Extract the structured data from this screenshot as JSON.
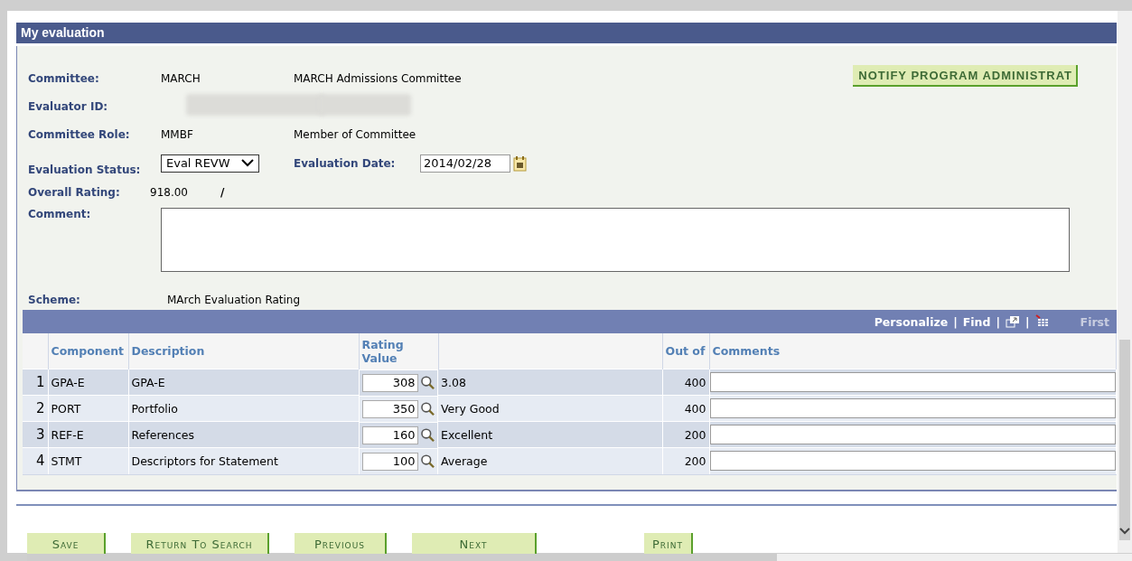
{
  "section": {
    "title": "My evaluation"
  },
  "notify_button": "NOTIFY PROGRAM ADMINISTRAT",
  "fields": [
    {
      "kind": "text",
      "label": "Committee:",
      "code": "MARCH",
      "description": "MARCH Admissions Committee"
    },
    {
      "kind": "blurred",
      "label": "Evaluator ID:"
    },
    {
      "kind": "text",
      "label": "Committee Role:",
      "code": "MMBF",
      "description": "Member of Committee"
    }
  ],
  "status": {
    "label": "Evaluation Status:",
    "value": "Eval REVW"
  },
  "date": {
    "label": "Evaluation Date:",
    "value": "2014/02/28"
  },
  "overall": {
    "label": "Overall Rating:",
    "value": "918.00",
    "separator": "/"
  },
  "comment": {
    "label": "Comment:"
  },
  "scheme": {
    "label": "Scheme:",
    "value": "MArch Evaluation Rating"
  },
  "grid_toolbar": [
    {
      "kind": "link",
      "text": "Personalize"
    },
    {
      "kind": "sep",
      "text": "|"
    },
    {
      "kind": "link",
      "text": "Find"
    },
    {
      "kind": "sep",
      "text": "|"
    },
    {
      "kind": "zoom"
    },
    {
      "kind": "sep",
      "text": "|"
    },
    {
      "kind": "download"
    }
  ],
  "grid_nav": {
    "text": "First",
    "disabled": true
  },
  "columns": [
    "Component",
    "Description",
    "Rating Value",
    "Out of",
    "Comments"
  ],
  "rows": [
    {
      "number": "1",
      "component": "GPA-E",
      "description": "GPA-E",
      "rating": "308",
      "rating_text": "3.08",
      "out_of": "400"
    },
    {
      "number": "2",
      "component": "PORT",
      "description": "Portfolio",
      "rating": "350",
      "rating_text": "Very Good",
      "out_of": "400"
    },
    {
      "number": "3",
      "component": "REF-E",
      "description": "References",
      "rating": "160",
      "rating_text": "Excellent",
      "out_of": "200"
    },
    {
      "number": "4",
      "component": "STMT",
      "description": "Descriptors for Statement",
      "rating": "100",
      "rating_text": "Average",
      "out_of": "200"
    }
  ],
  "buttons": [
    "Save",
    "Return To Search",
    "Previous",
    "Next",
    "Print"
  ]
}
